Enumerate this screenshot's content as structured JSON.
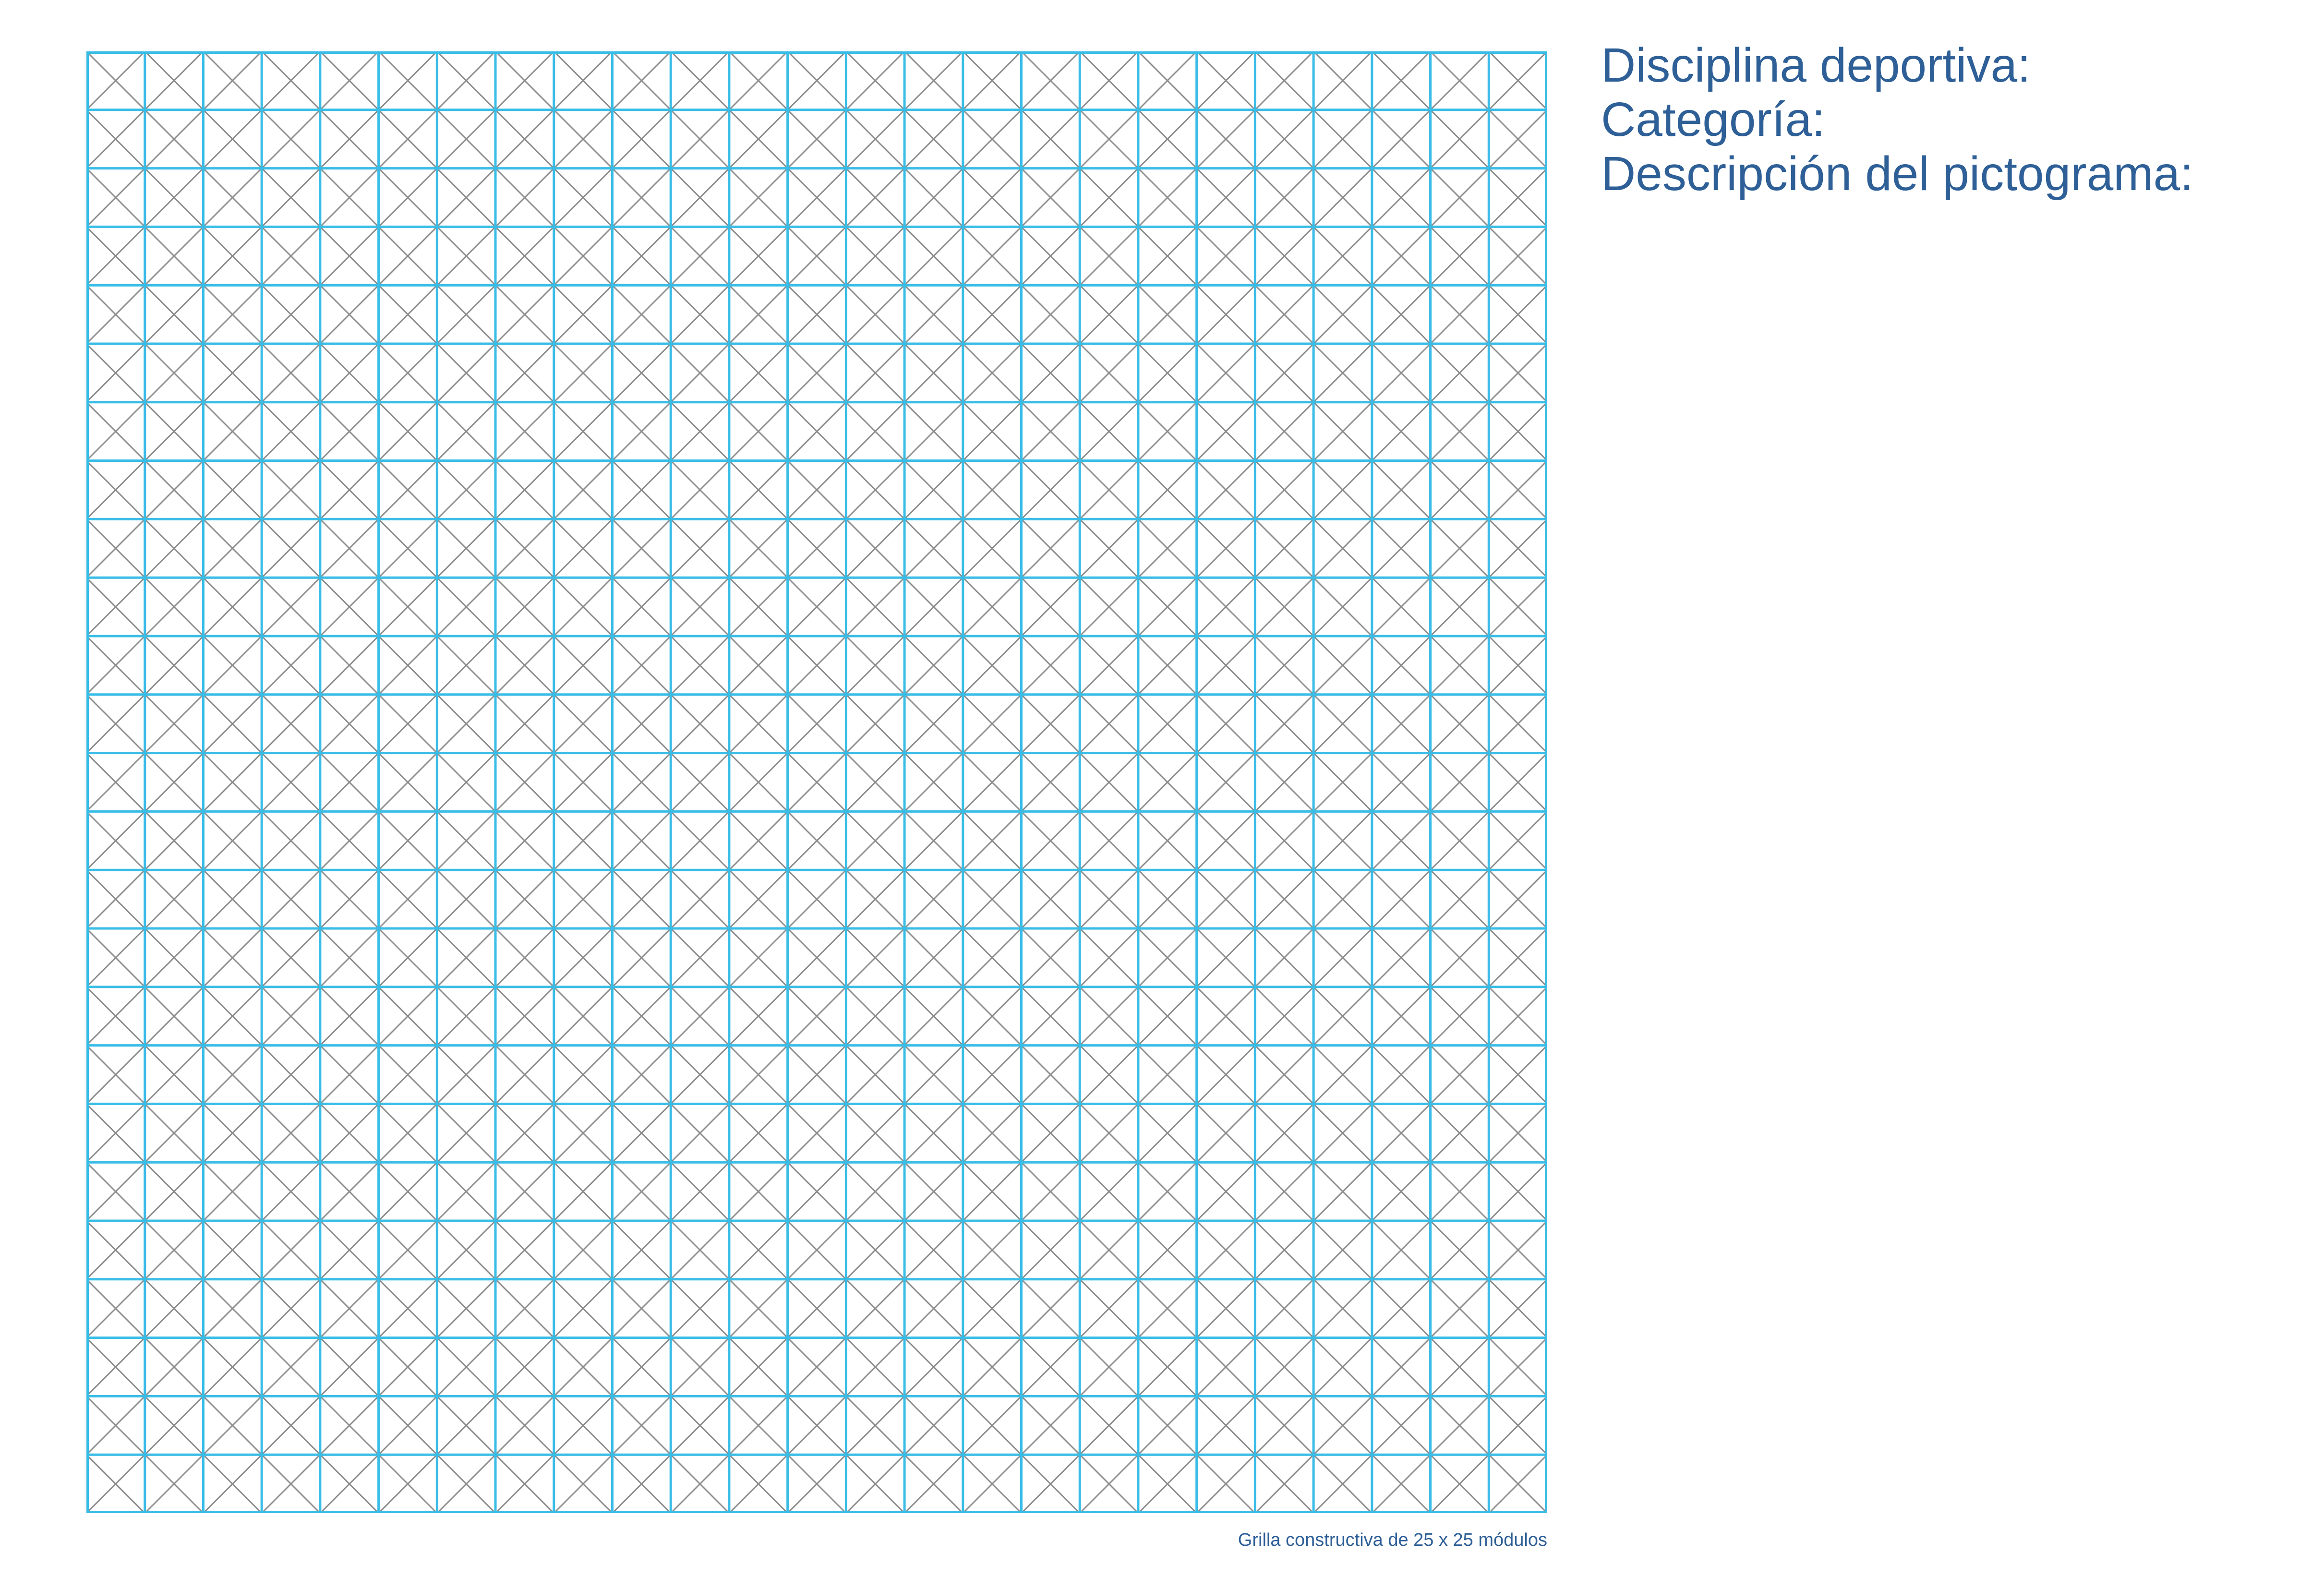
{
  "form": {
    "discipline_label": "Disciplina deportiva:",
    "category_label": "Categoría:",
    "description_label": "Descripción del pictograma:"
  },
  "grid": {
    "columns": 25,
    "rows": 25,
    "caption": "Grilla constructiva de 25 x 25 módulos",
    "module_line_color": "#39BDE6",
    "diagonal_line_color": "#8C8C8C"
  },
  "colors": {
    "label_text": "#2E5F97",
    "background": "#FFFFFF"
  }
}
